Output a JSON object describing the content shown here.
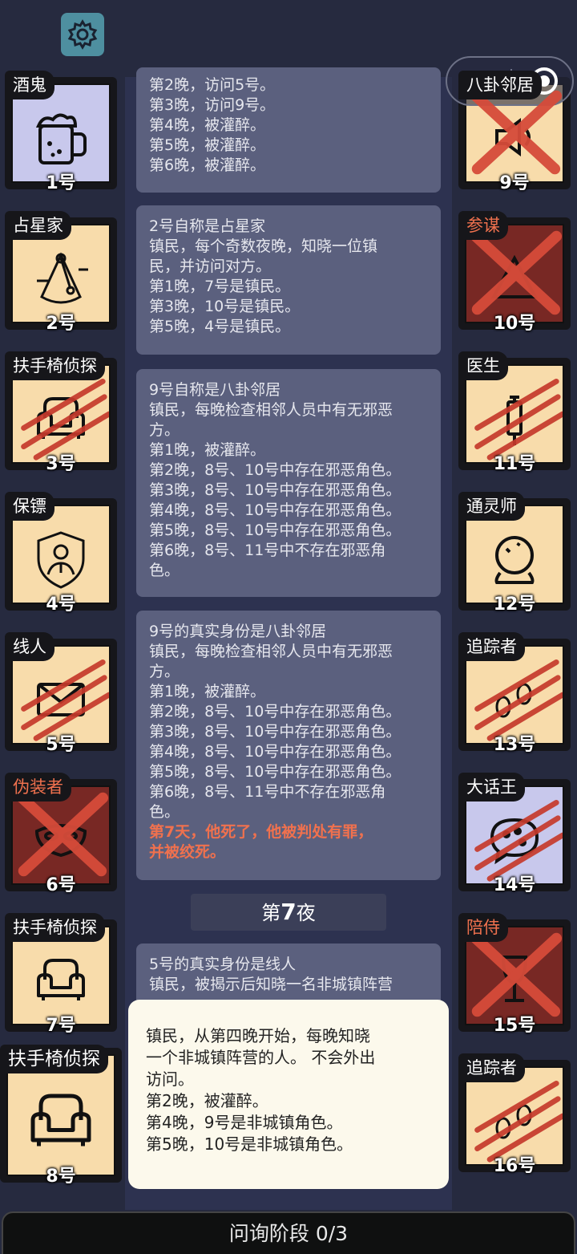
{
  "header": {
    "settings_icon": "gear-icon",
    "menu_icon": "more-dots-icon",
    "close_icon": "target-icon"
  },
  "colors": {
    "background": "#262a3f",
    "message_bg": "#5b607e",
    "card_tan": "#f8dcab",
    "card_lavender": "#c8c8ec",
    "card_dark_red": "#782824",
    "evil_text": "#f0714e",
    "slash_red": "#c63a2c"
  },
  "players_left": [
    {
      "role": "酒鬼",
      "num": "1号",
      "icon": "beer-mug-icon",
      "bg": "lavender",
      "mark": "none"
    },
    {
      "role": "占星家",
      "num": "2号",
      "icon": "sextant-icon",
      "bg": "tan",
      "mark": "none"
    },
    {
      "role": "扶手椅侦探",
      "num": "3号",
      "icon": "armchair-icon",
      "bg": "tan",
      "mark": "slash"
    },
    {
      "role": "保镖",
      "num": "4号",
      "icon": "bodyguard-shield-icon",
      "bg": "tan",
      "mark": "none"
    },
    {
      "role": "线人",
      "num": "5号",
      "icon": "envelope-icon",
      "bg": "tan",
      "mark": "slash"
    },
    {
      "role": "伪装者",
      "num": "6号",
      "icon": "mask-icon",
      "bg": "red",
      "mark": "cross",
      "evil": true
    },
    {
      "role": "扶手椅侦探",
      "num": "7号",
      "icon": "armchair-icon",
      "bg": "tan",
      "mark": "none"
    },
    {
      "role": "扶手椅侦探",
      "num": "8号",
      "icon": "armchair-icon",
      "bg": "tan",
      "mark": "none"
    }
  ],
  "players_right": [
    {
      "role": "八卦邻居",
      "num": "9号",
      "icon": "speaker-icon",
      "bg": "tan",
      "mark": "cross"
    },
    {
      "role": "参谋",
      "num": "10号",
      "icon": "strategist-icon",
      "bg": "red",
      "mark": "cross",
      "evil": true
    },
    {
      "role": "医生",
      "num": "11号",
      "icon": "syringe-icon",
      "bg": "tan",
      "mark": "slash"
    },
    {
      "role": "通灵师",
      "num": "12号",
      "icon": "crystal-ball-icon",
      "bg": "tan",
      "mark": "none"
    },
    {
      "role": "追踪者",
      "num": "13号",
      "icon": "footprints-icon",
      "bg": "tan",
      "mark": "slash"
    },
    {
      "role": "大话王",
      "num": "14号",
      "icon": "speech-bubble-icon",
      "bg": "lavender",
      "mark": "slash"
    },
    {
      "role": "陪侍",
      "num": "15号",
      "icon": "wine-glass-icon",
      "bg": "red",
      "mark": "cross",
      "evil": true
    },
    {
      "role": "追踪者",
      "num": "16号",
      "icon": "footprints-icon",
      "bg": "tan",
      "mark": "slash"
    }
  ],
  "messages": [
    {
      "lines": [
        "第2晚，访问5号。",
        "第3晚，访问9号。",
        "第4晚，被灌醉。",
        "第5晚，被灌醉。",
        "第6晚，被灌醉。"
      ]
    },
    {
      "lines": [
        "2号自称是占星家",
        "镇民，每个奇数夜晚，知晓一位镇",
        "民，并访问对方。",
        "第1晚，7号是镇民。",
        "第3晚，10号是镇民。",
        "第5晚，4号是镇民。"
      ]
    },
    {
      "lines": [
        "9号自称是八卦邻居",
        "镇民，每晚检查相邻人员中有无邪恶",
        "方。",
        "第1晚，被灌醉。",
        "第2晚，8号、10号中存在邪恶角色。",
        "第3晚，8号、10号中存在邪恶角色。",
        "第4晚，8号、10号中存在邪恶角色。",
        "第5晚，8号、10号中存在邪恶角色。",
        "第6晚，8号、11号中不存在邪恶角",
        "色。"
      ]
    },
    {
      "lines": [
        "9号的真实身份是八卦邻居",
        "镇民，每晚检查相邻人员中有无邪恶",
        "方。",
        "第1晚，被灌醉。",
        "第2晚，8号、10号中存在邪恶角色。",
        "第3晚，8号、10号中存在邪恶角色。",
        "第4晚，8号、10号中存在邪恶角色。",
        "第5晚，8号、10号中存在邪恶角色。",
        "第6晚，8号、11号中不存在邪恶角",
        "色。"
      ],
      "death": [
        "第7天，他死了，他被判处有罪，",
        "并被绞死。"
      ]
    },
    {
      "lines": [
        "5号的真实身份是线人",
        "镇民，被揭示后知晓一名非城镇阵营"
      ]
    }
  ],
  "night": {
    "prefix": "第",
    "number": "7",
    "suffix": "夜"
  },
  "tooltip": {
    "lines": [
      "镇民，从第四晚开始，每晚知晓",
      "一个非城镇阵营的人。 不会外出",
      "访问。",
      "第2晚，被灌醉。",
      "第4晚，9号是非城镇角色。",
      "第5晚，10号是非城镇角色。"
    ]
  },
  "phase": {
    "label": "问询阶段 0/3"
  }
}
